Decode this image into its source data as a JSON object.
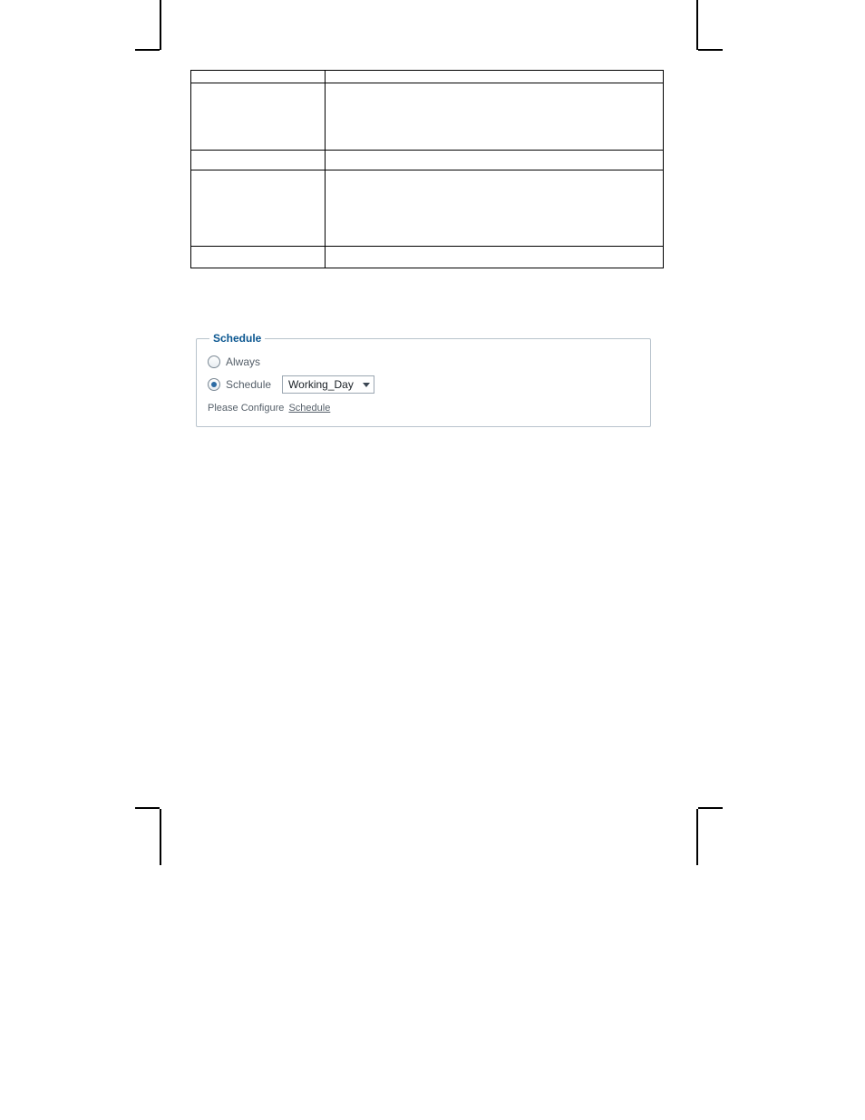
{
  "schedule": {
    "legend": "Schedule",
    "always_label": "Always",
    "schedule_label": "Schedule",
    "selected_option": "Working_Day",
    "hint_prefix": "Please Configure",
    "hint_link": "Schedule"
  }
}
